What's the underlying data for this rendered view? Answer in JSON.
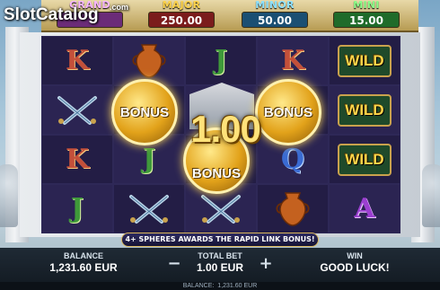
{
  "watermark": {
    "brand": "SlotCatalog",
    "suffix": ".com"
  },
  "jackpots": [
    {
      "label": "GRAND",
      "value": ""
    },
    {
      "label": "MAJOR",
      "value": "250.00"
    },
    {
      "label": "MINOR",
      "value": "50.00"
    },
    {
      "label": "MINI",
      "value": "15.00"
    }
  ],
  "reels": [
    [
      {
        "type": "K"
      },
      {
        "type": "urn"
      },
      {
        "type": "J"
      },
      {
        "type": "K"
      },
      {
        "type": "WILD"
      }
    ],
    [
      {
        "type": "swords"
      },
      {
        "type": "bonus"
      },
      {
        "type": "temple"
      },
      {
        "type": "bonus"
      },
      {
        "type": "WILD"
      }
    ],
    [
      {
        "type": "K"
      },
      {
        "type": "J"
      },
      {
        "type": "bonus"
      },
      {
        "type": "Q"
      },
      {
        "type": "WILD"
      }
    ],
    [
      {
        "type": "J"
      },
      {
        "type": "swords"
      },
      {
        "type": "swords"
      },
      {
        "type": "urn"
      },
      {
        "type": "A"
      }
    ]
  ],
  "bonus_label": "BONUS",
  "bonus_value": "1.00",
  "info_banner": "4+ SPHERES AWARDS THE RAPID LINK BONUS!",
  "bottom_bar": {
    "balance_label": "BALANCE",
    "balance_value": "1,231.60 EUR",
    "total_bet_label": "TOTAL BET",
    "total_bet_value": "1.00 EUR",
    "minus": "−",
    "plus": "+",
    "win_label": "WIN",
    "win_value": "GOOD LUCK!"
  },
  "status_bar": {
    "label": "BALANCE:",
    "value": "1,231.60 EUR"
  }
}
